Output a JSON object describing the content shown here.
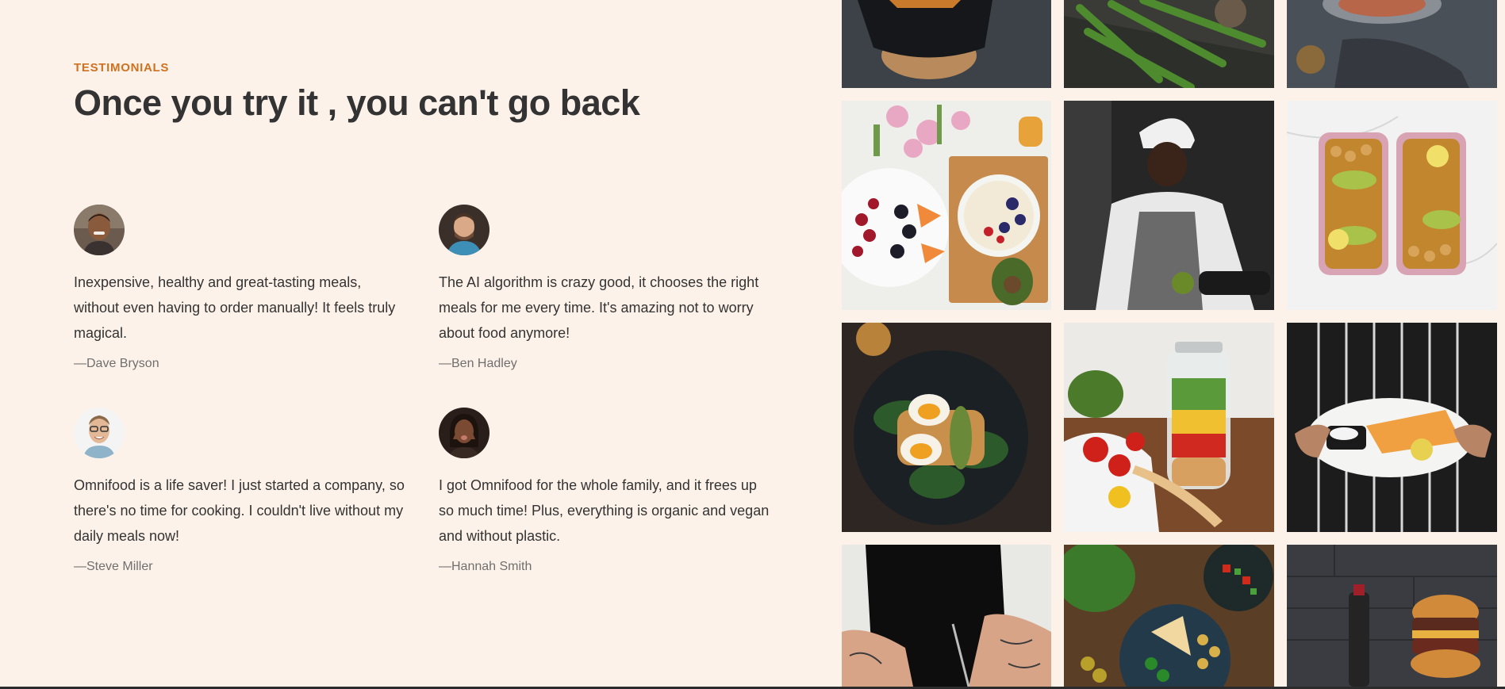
{
  "section": {
    "subheading": "Testimonials",
    "heading": "Once you try it , you can't go back"
  },
  "testimonials": [
    {
      "quote": "Inexpensive, healthy and great-tasting meals, without even having to order manually! It feels truly magical.",
      "author": "—Dave Bryson"
    },
    {
      "quote": "The AI algorithm is crazy good, it chooses the right meals for me every time. It's amazing not to worry about food anymore!",
      "author": "—Ben Hadley"
    },
    {
      "quote": "Omnifood is a life saver! I just started a company, so there's no time for cooking. I couldn't live without my daily meals now!",
      "author": "—Steve Miller"
    },
    {
      "quote": "I got Omnifood for the whole family, and it frees up so much time! Plus, everything is organic and vegan and without plastic.",
      "author": "—Hannah Smith"
    }
  ],
  "colors": {
    "background": "#fdf2e9",
    "accent": "#cf711f",
    "text": "#333333",
    "muted": "#6f6f6f"
  }
}
